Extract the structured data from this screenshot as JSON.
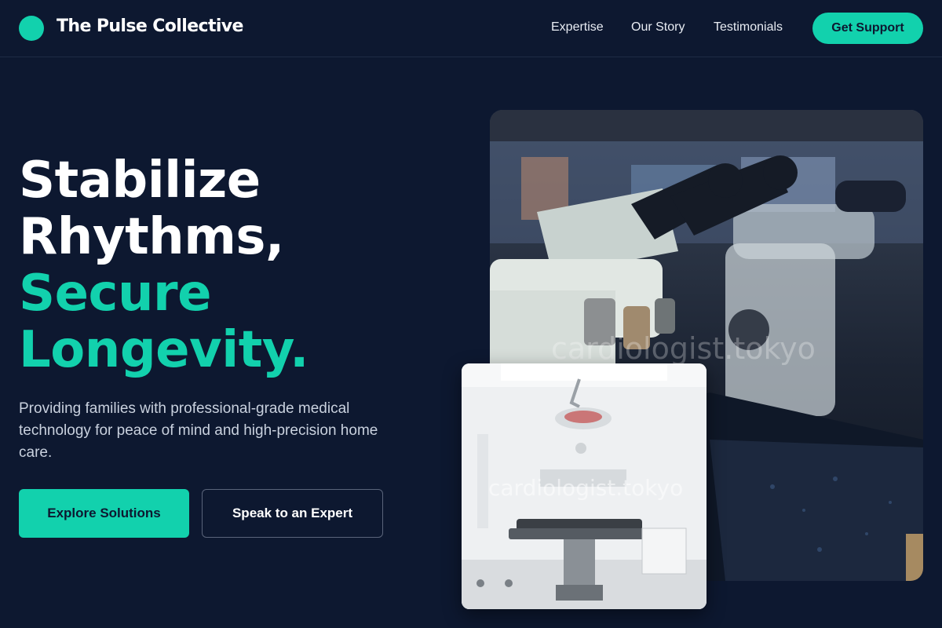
{
  "header": {
    "brand": "The Pulse Collective",
    "nav": [
      "Expertise",
      "Our Story",
      "Testimonials"
    ],
    "cta": "Get Support"
  },
  "hero": {
    "headline_lines": [
      "Stabilize",
      "Rhythms,",
      "Secure",
      "Longevity."
    ],
    "subcopy": "Providing families with professional-grade medical technology for peace of mind and high-precision home care.",
    "primary_button": "Explore Solutions",
    "secondary_button": "Speak to an Expert"
  },
  "images": {
    "large_watermark": "cardiologist.tokyo",
    "small_watermark": "cardiologist.tokyo"
  },
  "colors": {
    "background": "#0d1830",
    "accent": "#12d1ad",
    "text": "#ffffff",
    "muted_text": "#c9d1de"
  },
  "icons": {
    "logo": "teal-circle-logo"
  }
}
